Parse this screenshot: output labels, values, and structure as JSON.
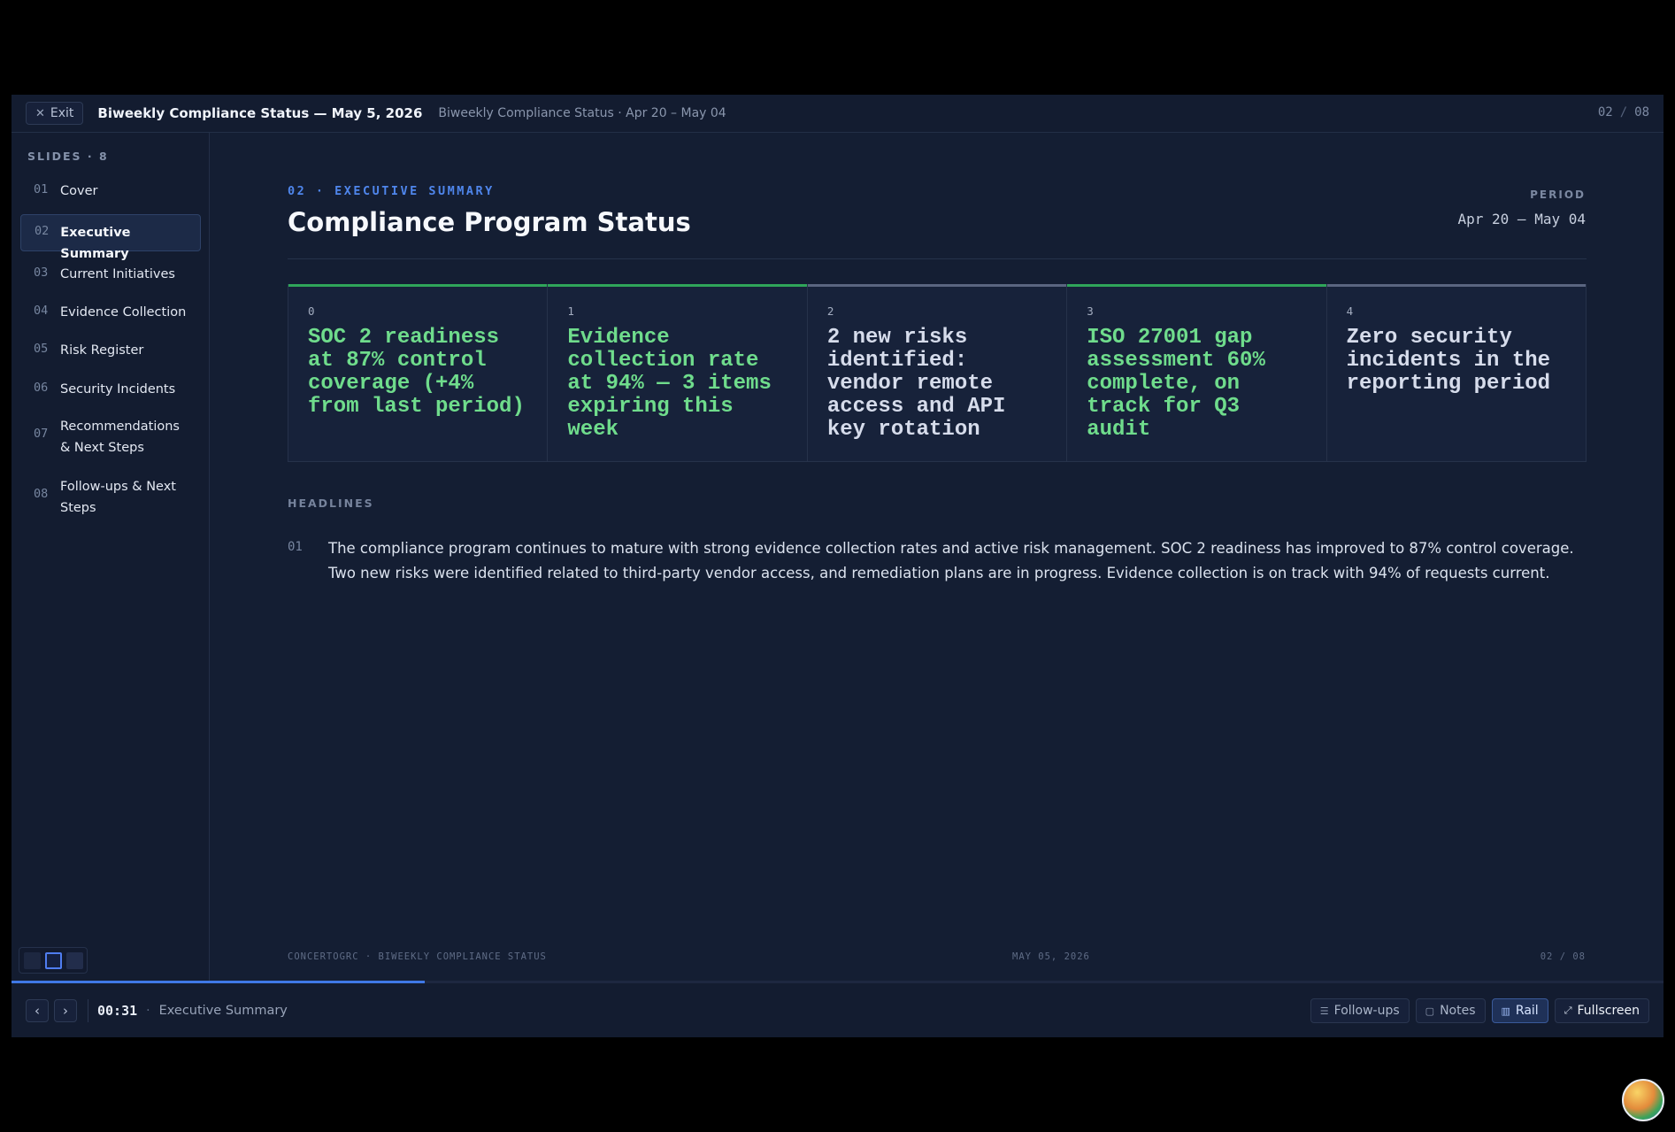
{
  "topbar": {
    "exit_label": "Exit",
    "title": "Biweekly Compliance Status — May 5, 2026",
    "subtitle": "Biweekly Compliance Status · Apr 20 – May 04",
    "counter_current": "02",
    "counter_sep": "/",
    "counter_total": "08"
  },
  "sidebar": {
    "heading": "SLIDES · 8",
    "items": [
      {
        "num": "01",
        "label": "Cover"
      },
      {
        "num": "02",
        "label": "Executive Summary"
      },
      {
        "num": "03",
        "label": "Current Initiatives"
      },
      {
        "num": "04",
        "label": "Evidence Collection"
      },
      {
        "num": "05",
        "label": "Risk Register"
      },
      {
        "num": "06",
        "label": "Security Incidents"
      },
      {
        "num": "07",
        "label": "Recommendations & Next Steps"
      },
      {
        "num": "08",
        "label": "Follow-ups & Next Steps"
      }
    ],
    "active_index": 1
  },
  "slide": {
    "eyebrow": "02 · EXECUTIVE SUMMARY",
    "title": "Compliance Program Status",
    "period_label": "PERIOD",
    "period_value": "Apr 20 – May 04",
    "cards": [
      {
        "idx": "0",
        "text": "SOC 2 readiness at 87% control coverage (+4% from last period)",
        "color": "#6fdc8c",
        "accent": "#2fa55a"
      },
      {
        "idx": "1",
        "text": "Evidence collection rate at 94% — 3 items expiring this week",
        "color": "#6fdc8c",
        "accent": "#2fa55a"
      },
      {
        "idx": "2",
        "text": "2 new risks identified: vendor remote access and API key rotation",
        "color": "#d6dceb",
        "accent": "#5a6580"
      },
      {
        "idx": "3",
        "text": "ISO 27001 gap assessment 60% complete, on track for Q3 audit",
        "color": "#6fdc8c",
        "accent": "#2fa55a"
      },
      {
        "idx": "4",
        "text": "Zero security incidents in the reporting period",
        "color": "#d6dceb",
        "accent": "#5a6580"
      }
    ],
    "headlines_label": "HEADLINES",
    "headline_num": "01",
    "headline_text": "The compliance program continues to mature with strong evidence collection rates and active risk management. SOC 2 readiness has improved to 87% control coverage. Two new risks were identified related to third-party vendor access, and remediation plans are in progress. Evidence collection is on track with 94% of requests current.",
    "footer_left": "CONCERTOGRC · BIWEEKLY COMPLIANCE STATUS",
    "footer_mid": "MAY 05, 2026",
    "footer_right": "02 / 08"
  },
  "progress_fraction": 0.25,
  "bottombar": {
    "prev_icon": "chevron-left-icon",
    "next_icon": "chevron-right-icon",
    "timer": "00:31",
    "current_title": "Executive Summary",
    "actions": {
      "followups": "Follow-ups",
      "notes": "Notes",
      "rail": "Rail",
      "fullscreen": "Fullscreen"
    }
  },
  "colors": {
    "accent": "#4f86ec",
    "positive": "#6fdc8c",
    "background": "#141e33"
  }
}
